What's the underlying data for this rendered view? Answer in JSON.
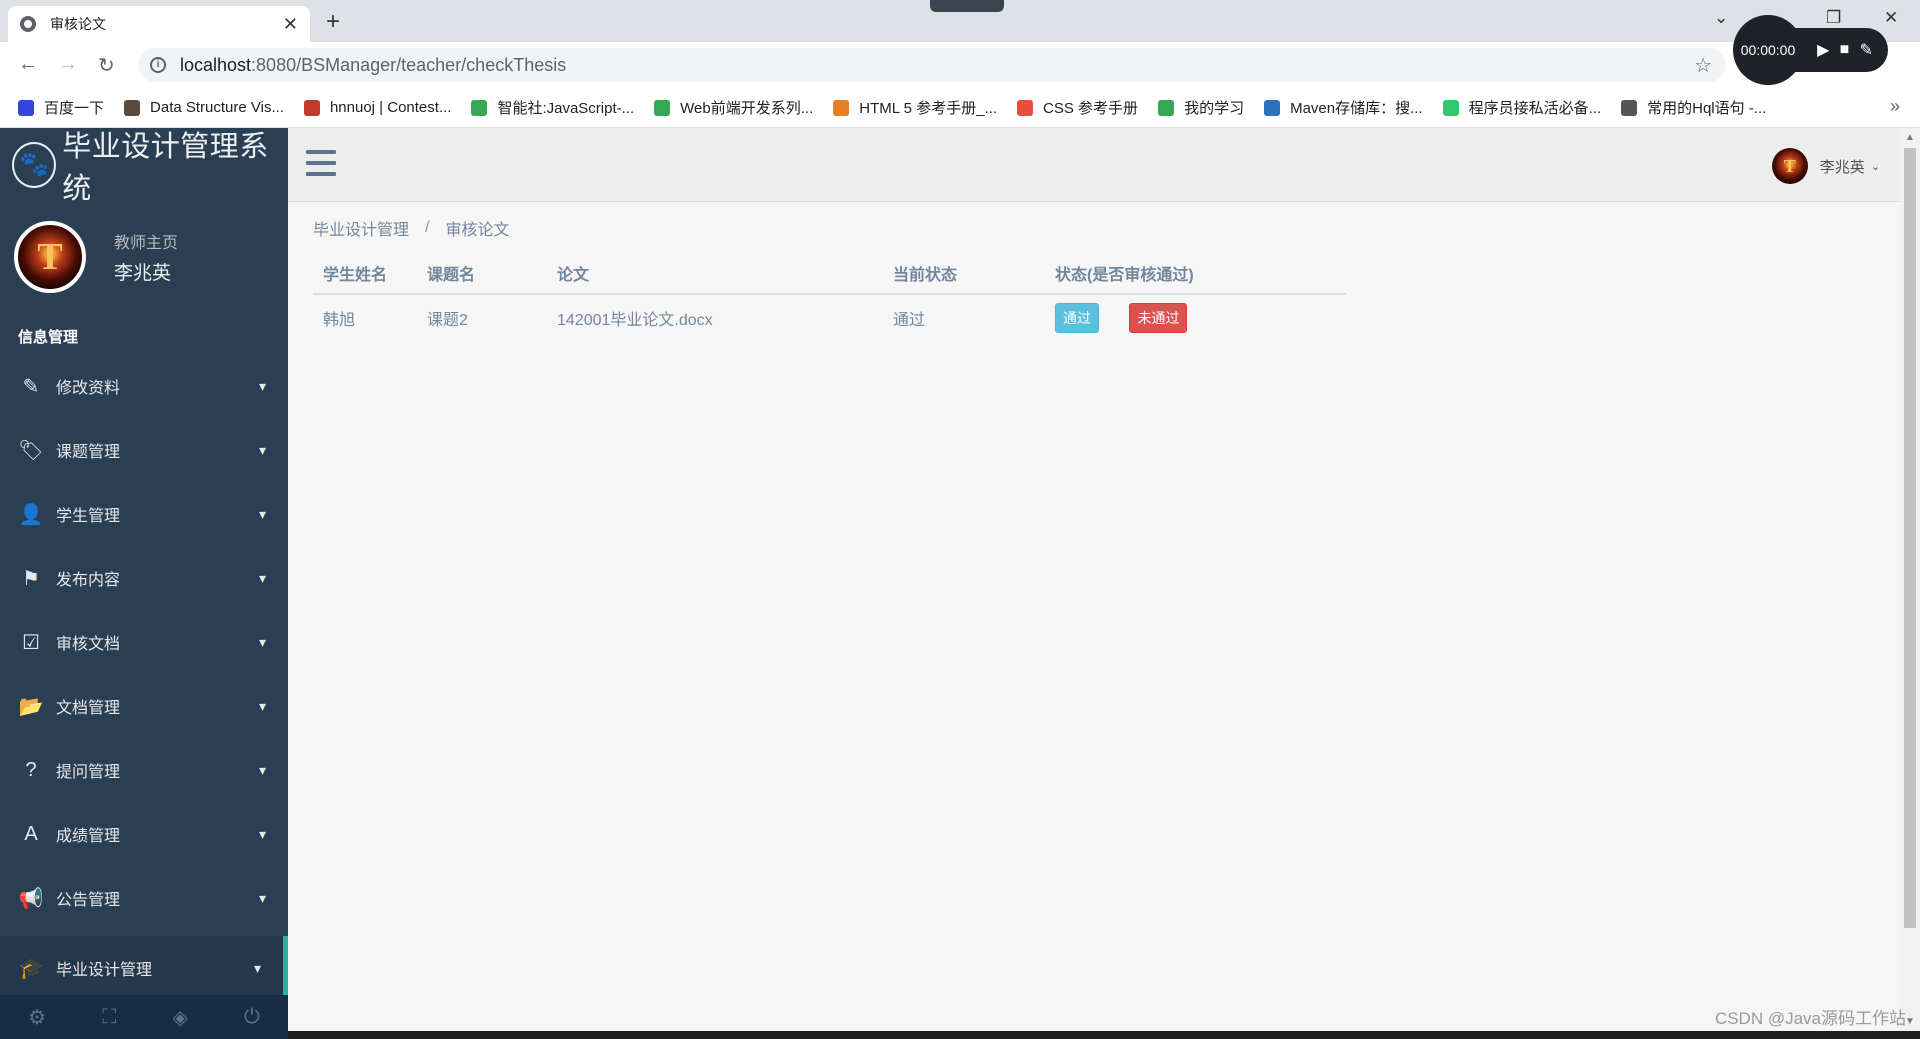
{
  "browser": {
    "tab_title": "审核论文",
    "url_host": "localhost",
    "url_path": ":8080/BSManager/teacher/checkThesis",
    "recorder_time": "00:00:00",
    "bookmarks": [
      {
        "label": "百度一下",
        "color": "#3245df"
      },
      {
        "label": "Data Structure Vis...",
        "color": "#5a4a3a"
      },
      {
        "label": "hnnuoj | Contest...",
        "color": "#c0392b"
      },
      {
        "label": "智能社:JavaScript-...",
        "color": "#34a853"
      },
      {
        "label": "Web前端开发系列...",
        "color": "#34a853"
      },
      {
        "label": "HTML 5 参考手册_...",
        "color": "#e67e22"
      },
      {
        "label": "CSS 参考手册",
        "color": "#e74c3c"
      },
      {
        "label": "我的学习",
        "color": "#34a853"
      },
      {
        "label": "Maven存储库：搜...",
        "color": "#2c6fbb"
      },
      {
        "label": "程序员接私活必备...",
        "color": "#2ecc71"
      },
      {
        "label": "常用的Hql语句 -...",
        "color": "#555555"
      }
    ]
  },
  "app": {
    "title": "毕业设计管理系统",
    "welcome": "教师主页",
    "user_name": "李兆英",
    "section_title": "信息管理",
    "menu": [
      {
        "label": "修改资料",
        "icon": "edit-icon"
      },
      {
        "label": "课题管理",
        "icon": "tags-icon"
      },
      {
        "label": "学生管理",
        "icon": "user-icon"
      },
      {
        "label": "发布内容",
        "icon": "flag-icon"
      },
      {
        "label": "审核文档",
        "icon": "check-square-icon"
      },
      {
        "label": "文档管理",
        "icon": "folder-open-icon"
      },
      {
        "label": "提问管理",
        "icon": "question-circle-icon"
      },
      {
        "label": "成绩管理",
        "icon": "font-icon"
      },
      {
        "label": "公告管理",
        "icon": "bullhorn-icon"
      },
      {
        "label": "毕业设计管理",
        "icon": "graduation-cap-icon"
      }
    ],
    "accent_color": "#1abb9c",
    "sidebar_color": "#2a3f54"
  },
  "breadcrumb": {
    "parent": "毕业设计管理",
    "current": "审核论文"
  },
  "table": {
    "headers": [
      "学生姓名",
      "课题名",
      "论文",
      "当前状态",
      "状态(是否审核通过)"
    ],
    "rows": [
      {
        "student": "韩旭",
        "topic": "课题2",
        "thesis": "142001毕业论文.docx",
        "status": "通过",
        "pass_label": "通过",
        "fail_label": "未通过"
      }
    ]
  },
  "watermark": "CSDN @Java源码工作站"
}
